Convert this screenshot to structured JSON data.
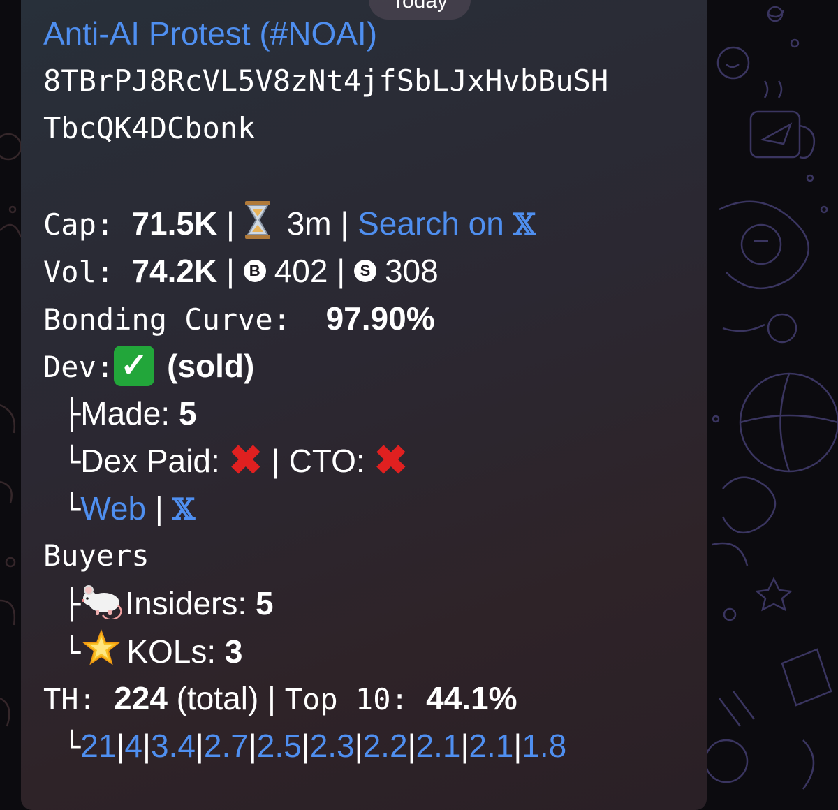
{
  "header": {
    "date_pill": "Today"
  },
  "message": {
    "title": "Anti-AI Protest (#NOAI)",
    "address_line1": "8TBrPJ8RcVL5V8zNt4jfSbLJxHvbBuSH",
    "address_line2": "TbcQK4DCbonk",
    "cap": {
      "label": "Cap: ",
      "value": "71.5K",
      "sep": " | ",
      "age": "3m",
      "sep2": " | ",
      "search_label": "Search on "
    },
    "vol": {
      "label": "Vol: ",
      "value": "74.2K",
      "sep": " | ",
      "buy_badge": "B",
      "buys": "402",
      "sep2": " | ",
      "sell_badge": "S",
      "sells": "308"
    },
    "bonding": {
      "label": "Bonding Curve:  ",
      "value": "97.90%"
    },
    "dev": {
      "label": "Dev:",
      "status": "(sold)",
      "made_prefix": "├",
      "made_label": "Made: ",
      "made_value": "5",
      "dex_prefix": "└",
      "dex_label": "Dex Paid: ",
      "cto_label": "CTO: ",
      "links_prefix": "└",
      "web_link": "Web",
      "sep": " | "
    },
    "buyers": {
      "label": "Buyers",
      "insiders_prefix": "├",
      "insiders_label": "Insiders: ",
      "insiders_value": "5",
      "kols_prefix": "└",
      "kols_label": "KOLs: ",
      "kols_value": "3"
    },
    "th": {
      "label": "TH: ",
      "total": "224",
      "total_suffix": " (total) | ",
      "top_label": "Top 10: ",
      "top_value": "44.1%",
      "holders_prefix": "└",
      "holders": [
        "21",
        "4",
        "3.4",
        "2.7",
        "2.5",
        "2.3",
        "2.2",
        "2.1",
        "2.1",
        "1.8"
      ]
    }
  },
  "colors": {
    "link": "#4f8ff0",
    "text": "#ffffff",
    "bubble": "#2b2832"
  },
  "icons": {
    "hourglass": "hourglass-icon",
    "x_logo": "x-logo-icon",
    "check": "check-mark-icon",
    "cross": "cross-mark-icon",
    "rat": "rat-icon",
    "star": "glowing-star-icon"
  }
}
